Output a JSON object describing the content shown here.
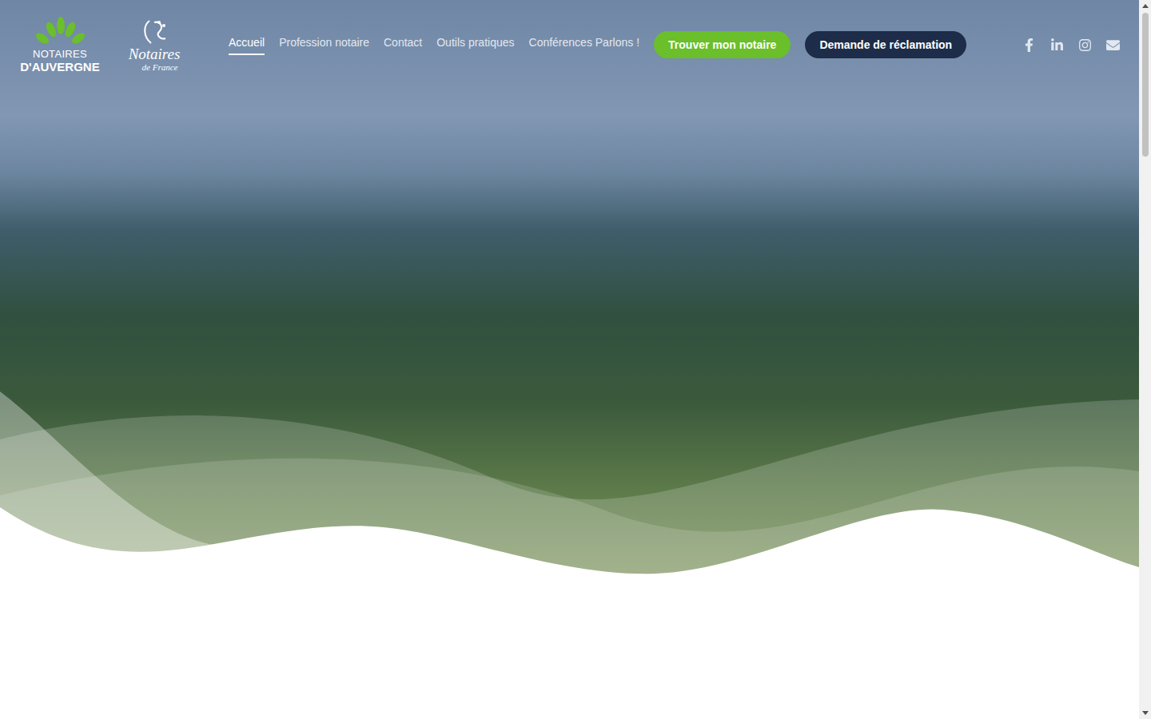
{
  "logos": {
    "regional": {
      "line1": "NOTAIRES",
      "line2": "D'AUVERGNE"
    },
    "national": {
      "line1": "Notaires",
      "line2": "de France"
    }
  },
  "nav": [
    {
      "label": "Accueil",
      "selected": true
    },
    {
      "label": "Profession notaire",
      "selected": false
    },
    {
      "label": "Contact",
      "selected": false
    },
    {
      "label": "Outils pratiques",
      "selected": false
    },
    {
      "label": "Conférences Parlons !",
      "selected": false
    }
  ],
  "buttons": [
    {
      "label": "Trouver mon notaire",
      "kind": "primary"
    },
    {
      "label": "Demande de réclamation",
      "kind": "secondary"
    }
  ]
}
